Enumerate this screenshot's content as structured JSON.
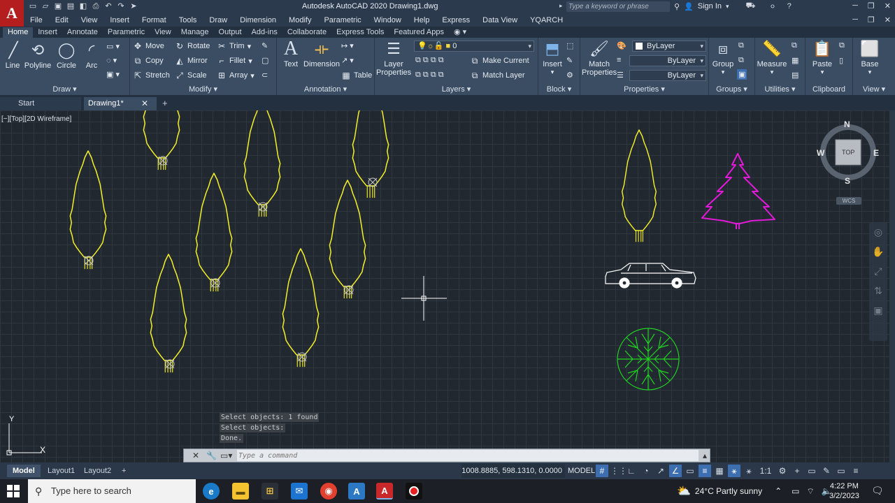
{
  "title_bar": {
    "title": "Autodesk AutoCAD 2020    Drawing1.dwg",
    "search_placeholder": "Type a keyword or phrase",
    "sign_in": "Sign In"
  },
  "app_logo": "A",
  "menu": [
    "File",
    "Edit",
    "View",
    "Insert",
    "Format",
    "Tools",
    "Draw",
    "Dimension",
    "Modify",
    "Parametric",
    "Window",
    "Help",
    "Express",
    "Data View",
    "YQARCH"
  ],
  "ribbon_tabs": [
    "Home",
    "Insert",
    "Annotate",
    "Parametric",
    "View",
    "Manage",
    "Output",
    "Add-ins",
    "Collaborate",
    "Express Tools",
    "Featured Apps"
  ],
  "ribbon": {
    "draw": {
      "title": "Draw",
      "line": "Line",
      "polyline": "Polyline",
      "circle": "Circle",
      "arc": "Arc"
    },
    "modify": {
      "title": "Modify",
      "move": "Move",
      "rotate": "Rotate",
      "trim": "Trim",
      "copy": "Copy",
      "mirror": "Mirror",
      "fillet": "Fillet",
      "stretch": "Stretch",
      "scale": "Scale",
      "array": "Array"
    },
    "annotation": {
      "title": "Annotation",
      "text": "Text",
      "dimension": "Dimension",
      "table": "Table"
    },
    "layers": {
      "title": "Layers",
      "layer_properties_1": "Layer",
      "layer_properties_2": "Properties",
      "current_layer": "0",
      "make_current": "Make Current",
      "match_layer": "Match Layer"
    },
    "block": {
      "title": "Block",
      "insert": "Insert"
    },
    "properties": {
      "title": "Properties",
      "match_1": "Match",
      "match_2": "Properties",
      "color": "ByLayer",
      "linetype": "ByLayer",
      "lineweight": "ByLayer"
    },
    "groups": {
      "title": "Groups",
      "group": "Group"
    },
    "utilities": {
      "title": "Utilities",
      "measure": "Measure"
    },
    "clipboard": {
      "title": "Clipboard",
      "paste": "Paste"
    },
    "view": {
      "title": "View",
      "base": "Base"
    }
  },
  "file_tabs": {
    "start": "Start",
    "drawing": "Drawing1*"
  },
  "viewport_label": "[−][Top][2D Wireframe]",
  "viewcube": {
    "n": "N",
    "s": "S",
    "e": "E",
    "w": "W",
    "face": "TOP",
    "wcs": "WCS"
  },
  "ucs": {
    "x": "X",
    "y": "Y"
  },
  "command_history": [
    "Select objects: 1 found",
    "Select objects:",
    "Done."
  ],
  "command_placeholder": "Type a command",
  "layout_tabs": [
    "Model",
    "Layout1",
    "Layout2"
  ],
  "status": {
    "coords": "1008.8885, 598.1310, 0.0000",
    "space": "MODEL",
    "scale": "1:1"
  },
  "taskbar": {
    "search_placeholder": "Type here to search",
    "weather": "24°C  Partly sunny",
    "time": "4:22 PM",
    "date": "3/2/2023"
  },
  "colors": {
    "tree_yellow": "#f2ee2a",
    "tree_magenta": "#e11ad8",
    "shrub_green": "#22d322",
    "car_white": "#ffffff",
    "canvas_bg": "#212830",
    "ribbon_bg": "#3b4d63"
  }
}
